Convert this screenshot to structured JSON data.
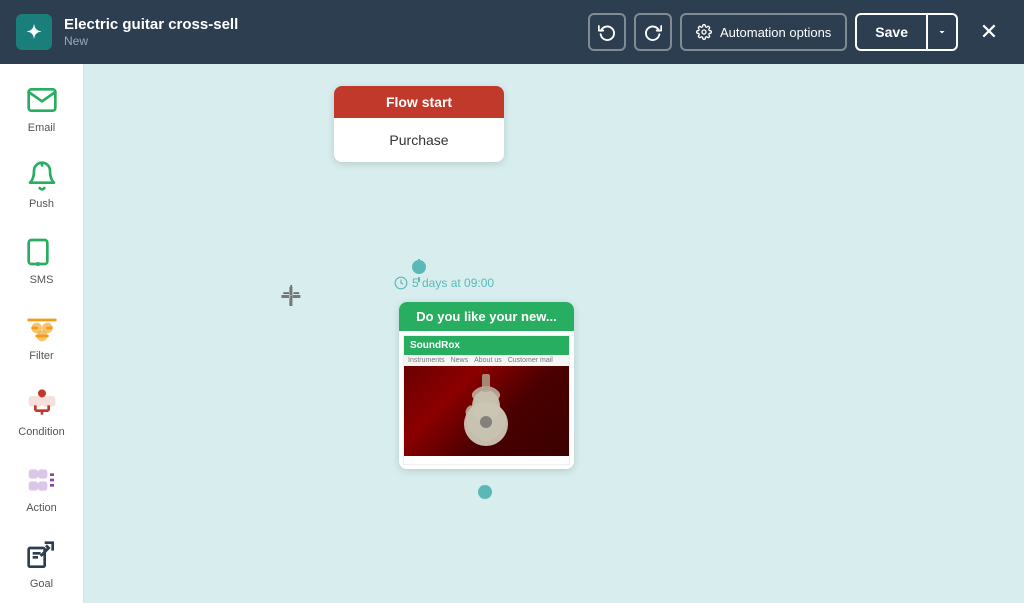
{
  "header": {
    "logo": "✦",
    "title": "Electric guitar cross-sell",
    "subtitle": "New",
    "undo_label": "↺",
    "redo_label": "↻",
    "automation_options_label": "Automation options",
    "save_label": "Save",
    "close_label": "✕",
    "gear_icon": "⚙"
  },
  "sidebar": {
    "items": [
      {
        "id": "email",
        "label": "Email"
      },
      {
        "id": "push",
        "label": "Push"
      },
      {
        "id": "sms",
        "label": "SMS"
      },
      {
        "id": "filter",
        "label": "Filter"
      },
      {
        "id": "condition",
        "label": "Condition"
      },
      {
        "id": "action",
        "label": "Action"
      },
      {
        "id": "goal",
        "label": "Goal"
      }
    ]
  },
  "canvas": {
    "flow_start": {
      "header": "Flow start",
      "body": "Purchase"
    },
    "time_delay": "5 days at 09:00",
    "email_card": {
      "header": "Do you like your new...",
      "preview_brand": "SoundRox",
      "nav_items": [
        "Instruments",
        "News",
        "About us",
        "Customer mail"
      ]
    }
  }
}
